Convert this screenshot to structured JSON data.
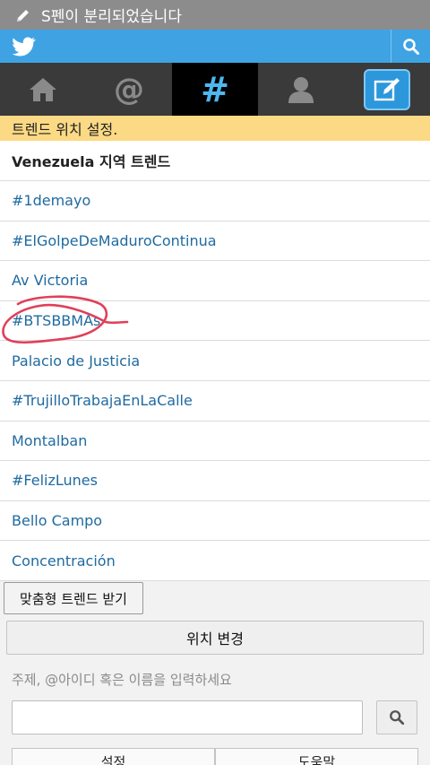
{
  "status_bar": {
    "notification": "S펜이 분리되었습니다"
  },
  "nav_tabs": [
    {
      "name": "home",
      "icon": "home-icon"
    },
    {
      "name": "mentions",
      "icon": "at-icon",
      "glyph": "@"
    },
    {
      "name": "discover",
      "icon": "hashtag-icon",
      "glyph": "#",
      "active": true
    },
    {
      "name": "profile",
      "icon": "person-icon"
    },
    {
      "name": "compose",
      "icon": "compose-icon"
    }
  ],
  "notice": "트렌드 위치 설정.",
  "trends": {
    "header": "Venezuela 지역 트렌드",
    "items": [
      "#1demayo",
      "#ElGolpeDeMaduroContinua",
      "Av Victoria",
      "#BTSBBMAs",
      "Palacio de Justicia",
      "#TrujilloTrabajaEnLaCalle",
      "Montalban",
      "#FelizLunes",
      "Bello Campo",
      "Concentración"
    ]
  },
  "buttons": {
    "custom_trends": "맞춤형 트렌드 받기",
    "change_location": "위치 변경"
  },
  "search": {
    "hint": "주제, @아이디 혹은 이름을 입력하세요",
    "value": ""
  },
  "bottom_tabs": [
    "설정",
    "도움말"
  ],
  "colors": {
    "twitter_blue": "#3fa3e3",
    "notice_yellow": "#fcd985",
    "link_blue": "#1f6aa0",
    "scribble_red": "#e0405a"
  }
}
